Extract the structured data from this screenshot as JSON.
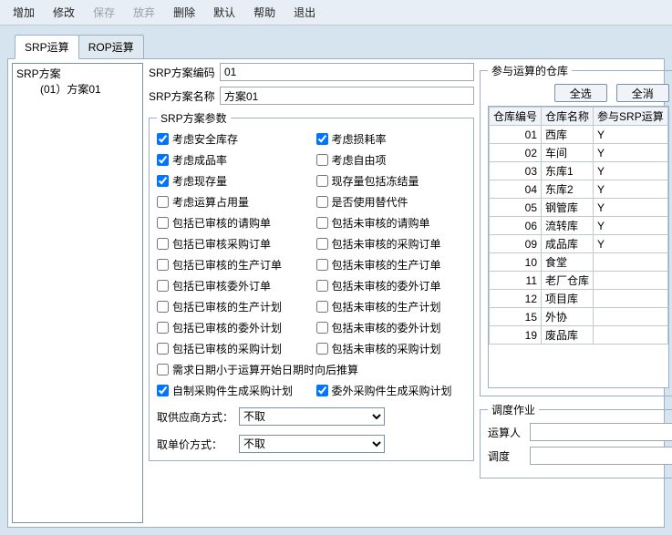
{
  "toolbar": {
    "add": "增加",
    "edit": "修改",
    "save": "保存",
    "abandon": "放弃",
    "delete": "删除",
    "default": "默认",
    "help": "帮助",
    "exit": "退出"
  },
  "tabs": {
    "srp": "SRP运算",
    "rop": "ROP运算"
  },
  "tree": {
    "root": "SRP方案",
    "child": "(01）方案01"
  },
  "form": {
    "code_label": "SRP方案编码",
    "code_value": "01",
    "name_label": "SRP方案名称",
    "name_value": "方案01"
  },
  "params_legend": "SRP方案参数",
  "params": [
    {
      "label": "考虑安全库存",
      "checked": true
    },
    {
      "label": "考虑损耗率",
      "checked": true
    },
    {
      "label": "考虑成品率",
      "checked": true
    },
    {
      "label": "考虑自由项",
      "checked": false
    },
    {
      "label": "考虑现存量",
      "checked": true
    },
    {
      "label": "现存量包括冻结量",
      "checked": false
    },
    {
      "label": "考虑运算占用量",
      "checked": false
    },
    {
      "label": "是否使用替代件",
      "checked": false
    },
    {
      "label": "包括已审核的请购单",
      "checked": false
    },
    {
      "label": "包括未审核的请购单",
      "checked": false
    },
    {
      "label": "包括已审核采购订单",
      "checked": false
    },
    {
      "label": "包括未审核的采购订单",
      "checked": false
    },
    {
      "label": "包括已审核的生产订单",
      "checked": false
    },
    {
      "label": "包括未审核的生产订单",
      "checked": false
    },
    {
      "label": "包括已审核委外订单",
      "checked": false
    },
    {
      "label": "包括未审核的委外订单",
      "checked": false
    },
    {
      "label": "包括已审核的生产计划",
      "checked": false
    },
    {
      "label": "包括未审核的生产计划",
      "checked": false
    },
    {
      "label": "包括已审核的委外计划",
      "checked": false
    },
    {
      "label": "包括未审核的委外计划",
      "checked": false
    },
    {
      "label": "包括已审核的采购计划",
      "checked": false
    },
    {
      "label": "包括未审核的采购计划",
      "checked": false
    },
    {
      "label": "需求日期小于运算开始日期时向后推算",
      "checked": false,
      "full": true
    },
    {
      "label": "自制采购件生成采购计划",
      "checked": true
    },
    {
      "label": "委外采购件生成采购计划",
      "checked": true
    }
  ],
  "supplier_label": "取供应商方式：",
  "price_label": "取单价方式：",
  "not_take": "不取",
  "warehouses": {
    "legend": "参与运算的仓库",
    "select_all": "全选",
    "deselect_all": "全消",
    "col_code": "仓库编号",
    "col_name": "仓库名称",
    "col_srp": "参与SRP运算",
    "rows": [
      {
        "code": "01",
        "name": "西库",
        "srp": "Y"
      },
      {
        "code": "02",
        "name": "车间",
        "srp": "Y"
      },
      {
        "code": "03",
        "name": "东库1",
        "srp": "Y"
      },
      {
        "code": "04",
        "name": "东库2",
        "srp": "Y"
      },
      {
        "code": "05",
        "name": "钢管库",
        "srp": "Y"
      },
      {
        "code": "06",
        "name": "流转库",
        "srp": "Y"
      },
      {
        "code": "09",
        "name": "成品库",
        "srp": "Y"
      },
      {
        "code": "10",
        "name": "食堂",
        "srp": ""
      },
      {
        "code": "11",
        "name": "老厂仓库",
        "srp": ""
      },
      {
        "code": "12",
        "name": "项目库",
        "srp": ""
      },
      {
        "code": "15",
        "name": "外协",
        "srp": ""
      },
      {
        "code": "19",
        "name": "废品库",
        "srp": ""
      }
    ]
  },
  "schedule": {
    "legend": "调度作业",
    "operator_label": "运算人",
    "dispatch_label": "调度",
    "operator_value": "",
    "dispatch_value": ""
  }
}
